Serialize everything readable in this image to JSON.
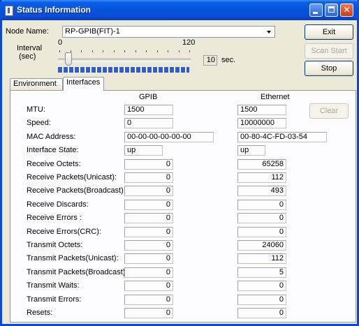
{
  "window": {
    "title": "Status Information"
  },
  "node": {
    "label": "Node Name:",
    "value": "RP-GPIB(FIT)-1"
  },
  "interval": {
    "label_line1": "Interval",
    "label_line2": "(sec)",
    "min": "0",
    "max": "120",
    "value": "10",
    "unit": "sec.",
    "level": 0.083
  },
  "buttons": {
    "exit": "Exit",
    "scan_start": "Scan Start",
    "stop": "Stop",
    "clear": "Clear"
  },
  "tabs": [
    {
      "label": "Environment",
      "active": false
    },
    {
      "label": "Interfaces",
      "active": true
    }
  ],
  "columns": {
    "gpib": "GPIB",
    "ethernet": "Ethernet"
  },
  "rows": [
    {
      "label": "MTU:",
      "gpib": "1500",
      "ethernet": "1500"
    },
    {
      "label": "Speed:",
      "gpib": "0",
      "ethernet": "10000000"
    },
    {
      "label": "MAC Address:",
      "gpib": "00-00-00-00-00-00",
      "ethernet": "00-80-4C-FD-03-54"
    },
    {
      "label": "Interface State:",
      "gpib": "up",
      "ethernet": "up"
    },
    {
      "label": "Receive Octets:",
      "gpib": "0",
      "ethernet": "65258"
    },
    {
      "label": "Receive Packets(Unicast):",
      "gpib": "0",
      "ethernet": "112"
    },
    {
      "label": "Receive Packets(Broadcast):",
      "gpib": "0",
      "ethernet": "493"
    },
    {
      "label": "Receive Discards:",
      "gpib": "0",
      "ethernet": "0"
    },
    {
      "label": "Receive Errors :",
      "gpib": "0",
      "ethernet": "0"
    },
    {
      "label": "Receive Errors(CRC):",
      "gpib": "0",
      "ethernet": "0"
    },
    {
      "label": "Transmit Octets:",
      "gpib": "0",
      "ethernet": "24060"
    },
    {
      "label": "Transmit Packets(Unicast):",
      "gpib": "0",
      "ethernet": "112"
    },
    {
      "label": "Transmit Packets(Broadcast):",
      "gpib": "0",
      "ethernet": "5"
    },
    {
      "label": "Transmit Waits:",
      "gpib": "0",
      "ethernet": "0"
    },
    {
      "label": "Transmit Errors:",
      "gpib": "0",
      "ethernet": "0"
    },
    {
      "label": "Resets:",
      "gpib": "0",
      "ethernet": "0"
    }
  ]
}
